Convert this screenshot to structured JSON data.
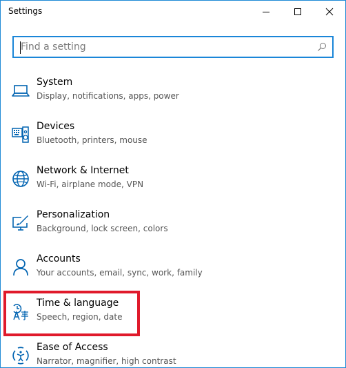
{
  "window": {
    "title": "Settings"
  },
  "search": {
    "placeholder": "Find a setting",
    "value": ""
  },
  "items": [
    {
      "label": "System",
      "desc": "Display, notifications, apps, power",
      "icon": "laptop-icon"
    },
    {
      "label": "Devices",
      "desc": "Bluetooth, printers, mouse",
      "icon": "devices-icon"
    },
    {
      "label": "Network & Internet",
      "desc": "Wi-Fi, airplane mode, VPN",
      "icon": "globe-icon"
    },
    {
      "label": "Personalization",
      "desc": "Background, lock screen, colors",
      "icon": "personalization-icon"
    },
    {
      "label": "Accounts",
      "desc": "Your accounts, email, sync, work, family",
      "icon": "person-icon"
    },
    {
      "label": "Time & language",
      "desc": "Speech, region, date",
      "icon": "time-language-icon"
    },
    {
      "label": "Ease of Access",
      "desc": "Narrator, magnifier, high contrast",
      "icon": "ease-of-access-icon"
    }
  ],
  "colors": {
    "accent": "#0063b1",
    "search_border": "#1a86d8",
    "highlight": "#e01a2b"
  }
}
